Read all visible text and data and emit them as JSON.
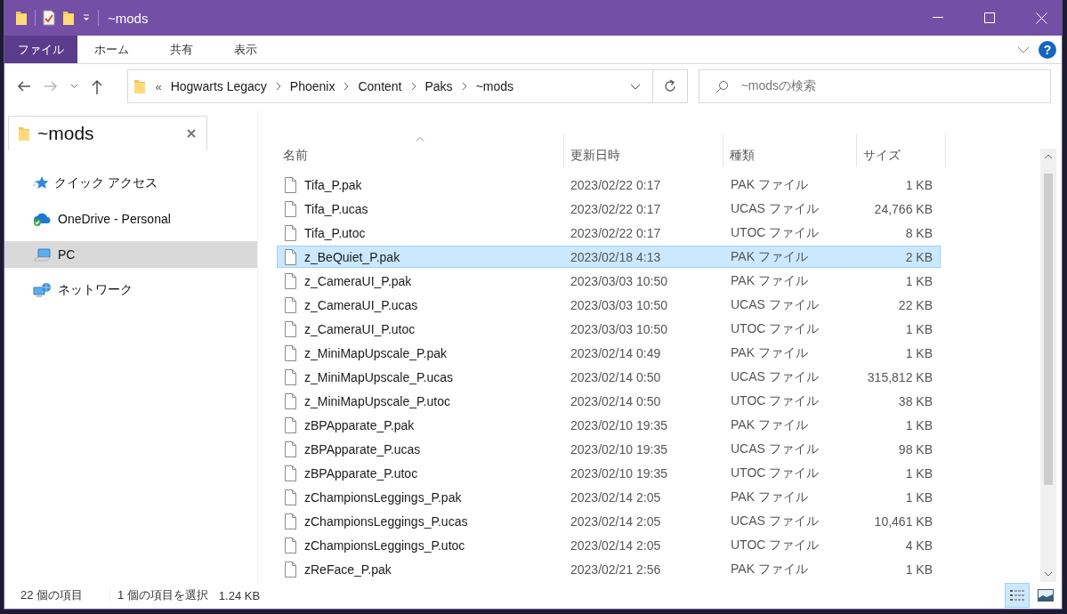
{
  "window": {
    "title": "~mods"
  },
  "ribbon": {
    "tabs": [
      {
        "label": "ファイル",
        "kind": "file"
      },
      {
        "label": "ホーム",
        "kind": "tab"
      },
      {
        "label": "共有",
        "kind": "tab"
      },
      {
        "label": "表示",
        "kind": "tab"
      }
    ],
    "help": "?"
  },
  "address": {
    "overflow": "«",
    "path": [
      "Hogwarts Legacy",
      "Phoenix",
      "Content",
      "Paks",
      "~mods"
    ]
  },
  "search": {
    "placeholder": "~modsの検索"
  },
  "folder_tab": {
    "label": "~mods"
  },
  "sidebar": {
    "items": [
      {
        "label": "クイック アクセス",
        "kind": "quick",
        "selected": false
      },
      {
        "label": "OneDrive - Personal",
        "kind": "cloud",
        "selected": false
      },
      {
        "label": "PC",
        "kind": "pc",
        "selected": true
      },
      {
        "label": "ネットワーク",
        "kind": "network",
        "selected": false
      }
    ]
  },
  "table": {
    "columns": [
      {
        "label": "名前",
        "sorted": true
      },
      {
        "label": "更新日時",
        "sorted": false
      },
      {
        "label": "種類",
        "sorted": false
      },
      {
        "label": "サイズ",
        "sorted": false
      }
    ],
    "rows": [
      {
        "name": "Tifa_P.pak",
        "date": "2023/02/22 0:17",
        "type": "PAK ファイル",
        "size": "1 KB",
        "selected": false
      },
      {
        "name": "Tifa_P.ucas",
        "date": "2023/02/22 0:17",
        "type": "UCAS ファイル",
        "size": "24,766 KB",
        "selected": false
      },
      {
        "name": "Tifa_P.utoc",
        "date": "2023/02/22 0:17",
        "type": "UTOC ファイル",
        "size": "8 KB",
        "selected": false
      },
      {
        "name": "z_BeQuiet_P.pak",
        "date": "2023/02/18 4:13",
        "type": "PAK ファイル",
        "size": "2 KB",
        "selected": true
      },
      {
        "name": "z_CameraUI_P.pak",
        "date": "2023/03/03 10:50",
        "type": "PAK ファイル",
        "size": "1 KB",
        "selected": false
      },
      {
        "name": "z_CameraUI_P.ucas",
        "date": "2023/03/03 10:50",
        "type": "UCAS ファイル",
        "size": "22 KB",
        "selected": false
      },
      {
        "name": "z_CameraUI_P.utoc",
        "date": "2023/03/03 10:50",
        "type": "UTOC ファイル",
        "size": "1 KB",
        "selected": false
      },
      {
        "name": "z_MiniMapUpscale_P.pak",
        "date": "2023/02/14 0:49",
        "type": "PAK ファイル",
        "size": "1 KB",
        "selected": false
      },
      {
        "name": "z_MiniMapUpscale_P.ucas",
        "date": "2023/02/14 0:50",
        "type": "UCAS ファイル",
        "size": "315,812 KB",
        "selected": false
      },
      {
        "name": "z_MiniMapUpscale_P.utoc",
        "date": "2023/02/14 0:50",
        "type": "UTOC ファイル",
        "size": "38 KB",
        "selected": false
      },
      {
        "name": "zBPApparate_P.pak",
        "date": "2023/02/10 19:35",
        "type": "PAK ファイル",
        "size": "1 KB",
        "selected": false
      },
      {
        "name": "zBPApparate_P.ucas",
        "date": "2023/02/10 19:35",
        "type": "UCAS ファイル",
        "size": "98 KB",
        "selected": false
      },
      {
        "name": "zBPApparate_P.utoc",
        "date": "2023/02/10 19:35",
        "type": "UTOC ファイル",
        "size": "1 KB",
        "selected": false
      },
      {
        "name": "zChampionsLeggings_P.pak",
        "date": "2023/02/14 2:05",
        "type": "PAK ファイル",
        "size": "1 KB",
        "selected": false
      },
      {
        "name": "zChampionsLeggings_P.ucas",
        "date": "2023/02/14 2:05",
        "type": "UCAS ファイル",
        "size": "10,461 KB",
        "selected": false
      },
      {
        "name": "zChampionsLeggings_P.utoc",
        "date": "2023/02/14 2:05",
        "type": "UTOC ファイル",
        "size": "4 KB",
        "selected": false
      },
      {
        "name": "zReFace_P.pak",
        "date": "2023/02/21 2:56",
        "type": "PAK ファイル",
        "size": "1 KB",
        "selected": false
      }
    ]
  },
  "status_bar": {
    "item_count": "22 個の項目",
    "selection": "1 個の項目を選択",
    "selection_size": "1.24 KB"
  },
  "view_buttons": [
    {
      "kind": "details",
      "selected": true
    },
    {
      "kind": "large-icons",
      "selected": false
    }
  ]
}
